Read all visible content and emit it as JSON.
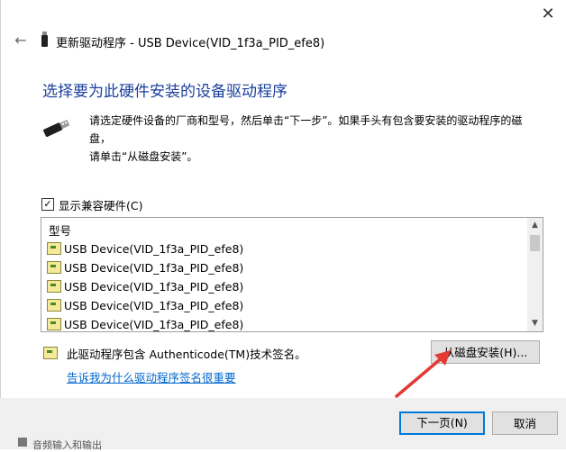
{
  "window": {
    "title": "更新驱动程序 - USB Device(VID_1f3a_PID_efe8)",
    "close_glyph": "✕",
    "back_glyph": "←"
  },
  "heading": "选择要为此硬件安装的设备驱动程序",
  "instruction": {
    "line1": "请选定硬件设备的厂商和型号，然后单击“下一步”。如果手头有包含要安装的驱动程序的磁盘，",
    "line2": "请单击“从磁盘安装”。"
  },
  "compat": {
    "label": "显示兼容硬件(C)",
    "checked": true,
    "check_glyph": "✓"
  },
  "list": {
    "header": "型号",
    "items": [
      "USB Device(VID_1f3a_PID_efe8)",
      "USB Device(VID_1f3a_PID_efe8)",
      "USB Device(VID_1f3a_PID_efe8)",
      "USB Device(VID_1f3a_PID_efe8)",
      "USB Device(VID_1f3a_PID_efe8)"
    ],
    "scroll_up_glyph": "▲",
    "scroll_down_glyph": "▼"
  },
  "signature": {
    "text": "此驱动程序包含 Authenticode(TM)技术签名。",
    "link": "告诉我为什么驱动程序签名很重要"
  },
  "buttons": {
    "have_disk": "从磁盘安装(H)...",
    "next": "下一页(N)",
    "cancel": "取消"
  },
  "background_peek": "音频输入和输出",
  "colors": {
    "heading": "#1a3f9c",
    "link": "#0066cc",
    "annotation_arrow": "#e53935",
    "focus_border": "#0078d7"
  },
  "icons": {
    "usb": "usb-drive-icon",
    "driver_row": "driver-package-icon",
    "signature": "certificate-icon"
  }
}
